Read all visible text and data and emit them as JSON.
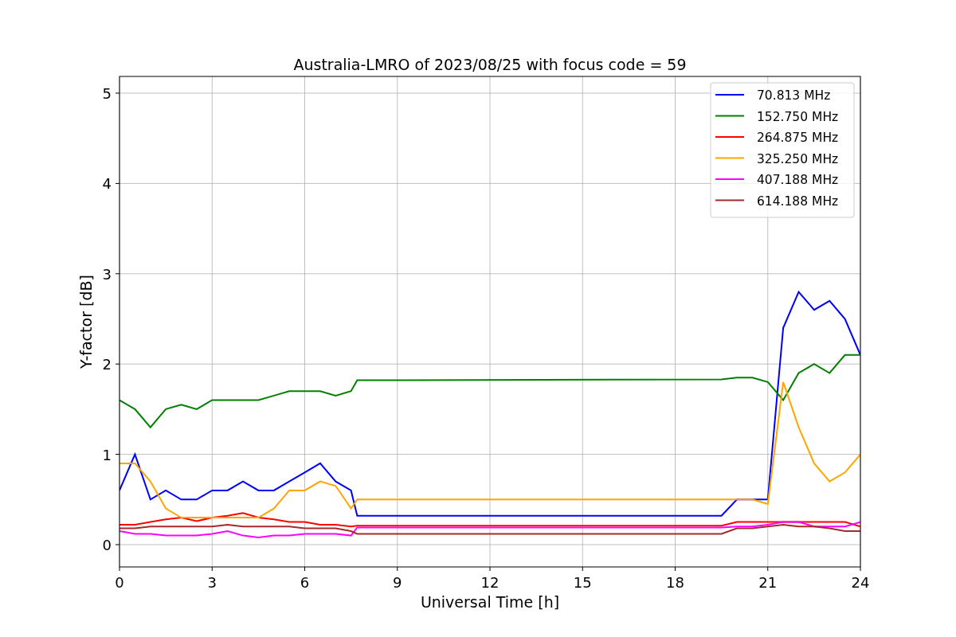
{
  "chart_data": {
    "type": "line",
    "title": "Australia-LMRO of 2023/08/25 with focus code = 59",
    "xlabel": "Universal Time [h]",
    "ylabel": "Y-factor [dB]",
    "x": [
      0,
      0.5,
      1,
      1.5,
      2,
      2.5,
      3,
      3.5,
      4,
      4.5,
      5,
      5.5,
      6,
      6.5,
      7,
      7.5,
      7.7,
      19.5,
      20,
      20.5,
      21,
      21.5,
      22,
      22.5,
      23,
      23.5,
      24
    ],
    "series": [
      {
        "name": "70.813 MHz",
        "color": "#0000ff",
        "values": [
          0.6,
          1.0,
          0.5,
          0.6,
          0.5,
          0.5,
          0.6,
          0.6,
          0.7,
          0.6,
          0.6,
          0.7,
          0.8,
          0.9,
          0.7,
          0.6,
          0.32,
          0.32,
          0.5,
          0.5,
          0.5,
          2.4,
          2.8,
          2.6,
          2.7,
          2.5,
          2.1
        ]
      },
      {
        "name": "152.750 MHz",
        "color": "#008000",
        "values": [
          1.6,
          1.5,
          1.3,
          1.5,
          1.55,
          1.5,
          1.6,
          1.6,
          1.6,
          1.6,
          1.65,
          1.7,
          1.7,
          1.7,
          1.65,
          1.7,
          1.82,
          1.83,
          1.85,
          1.85,
          1.8,
          1.6,
          1.9,
          2.0,
          1.9,
          2.1,
          2.1
        ]
      },
      {
        "name": "264.875 MHz",
        "color": "#ff0000",
        "values": [
          0.22,
          0.22,
          0.25,
          0.28,
          0.3,
          0.26,
          0.3,
          0.32,
          0.35,
          0.3,
          0.28,
          0.25,
          0.25,
          0.22,
          0.22,
          0.2,
          0.21,
          0.21,
          0.25,
          0.25,
          0.25,
          0.25,
          0.25,
          0.25,
          0.25,
          0.25,
          0.2
        ]
      },
      {
        "name": "325.250 MHz",
        "color": "#ffa500",
        "values": [
          0.9,
          0.9,
          0.7,
          0.4,
          0.3,
          0.3,
          0.3,
          0.3,
          0.3,
          0.3,
          0.4,
          0.6,
          0.6,
          0.7,
          0.65,
          0.4,
          0.5,
          0.5,
          0.5,
          0.5,
          0.45,
          1.8,
          1.3,
          0.9,
          0.7,
          0.8,
          1.0
        ]
      },
      {
        "name": "407.188 MHz",
        "color": "#ff00ff",
        "values": [
          0.15,
          0.12,
          0.12,
          0.1,
          0.1,
          0.1,
          0.12,
          0.15,
          0.1,
          0.08,
          0.1,
          0.1,
          0.12,
          0.12,
          0.12,
          0.1,
          0.19,
          0.19,
          0.2,
          0.2,
          0.22,
          0.25,
          0.25,
          0.2,
          0.2,
          0.2,
          0.25
        ]
      },
      {
        "name": "614.188 MHz",
        "color": "#a52a2a",
        "values": [
          0.18,
          0.18,
          0.2,
          0.2,
          0.2,
          0.2,
          0.2,
          0.22,
          0.2,
          0.2,
          0.2,
          0.2,
          0.18,
          0.18,
          0.18,
          0.15,
          0.12,
          0.12,
          0.18,
          0.18,
          0.2,
          0.22,
          0.2,
          0.2,
          0.18,
          0.15,
          0.15
        ]
      }
    ],
    "xlim": [
      0,
      24
    ],
    "ylim": [
      -0.247,
      5.185
    ],
    "xticks": [
      0,
      3,
      6,
      9,
      12,
      15,
      18,
      21,
      24
    ],
    "yticks": [
      0,
      1,
      2,
      3,
      4,
      5
    ],
    "grid": true,
    "legend": true
  }
}
